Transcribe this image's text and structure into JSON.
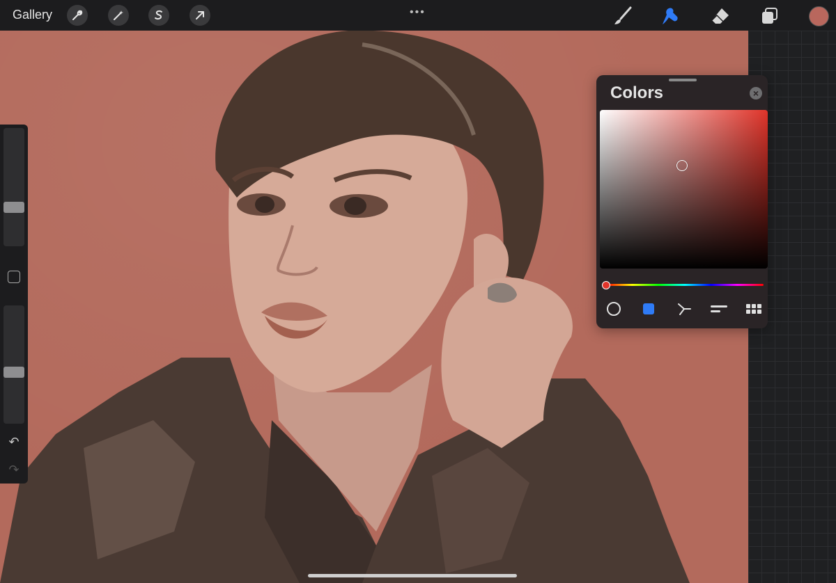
{
  "topbar": {
    "gallery_label": "Gallery",
    "left_tools": [
      "wrench-icon",
      "magic-wand-icon",
      "selection-s-icon",
      "transform-arrow-icon"
    ],
    "more_label": "•••",
    "right_tools": [
      "brush-icon",
      "smudge-icon",
      "eraser-icon",
      "layers-icon"
    ],
    "active_tool": "smudge-icon",
    "current_color": "#b9675d"
  },
  "sidebar": {
    "brush_size": 0.31,
    "opacity": 0.43,
    "undo_icon": "↶",
    "redo_icon": "↷"
  },
  "colors_panel": {
    "title": "Colors",
    "close_label": "×",
    "hue_color": "#e0342a",
    "picker_saturation": 0.49,
    "picker_brightness": 0.65,
    "hue": 0.0,
    "tabs": [
      "disc-icon",
      "classic-square-icon",
      "harmony-icon",
      "value-icon",
      "palettes-icon"
    ],
    "active_tab": "classic-square-icon"
  },
  "colors": {
    "accent": "#2f7bf6",
    "canvas_bg": "#b36a5c"
  }
}
